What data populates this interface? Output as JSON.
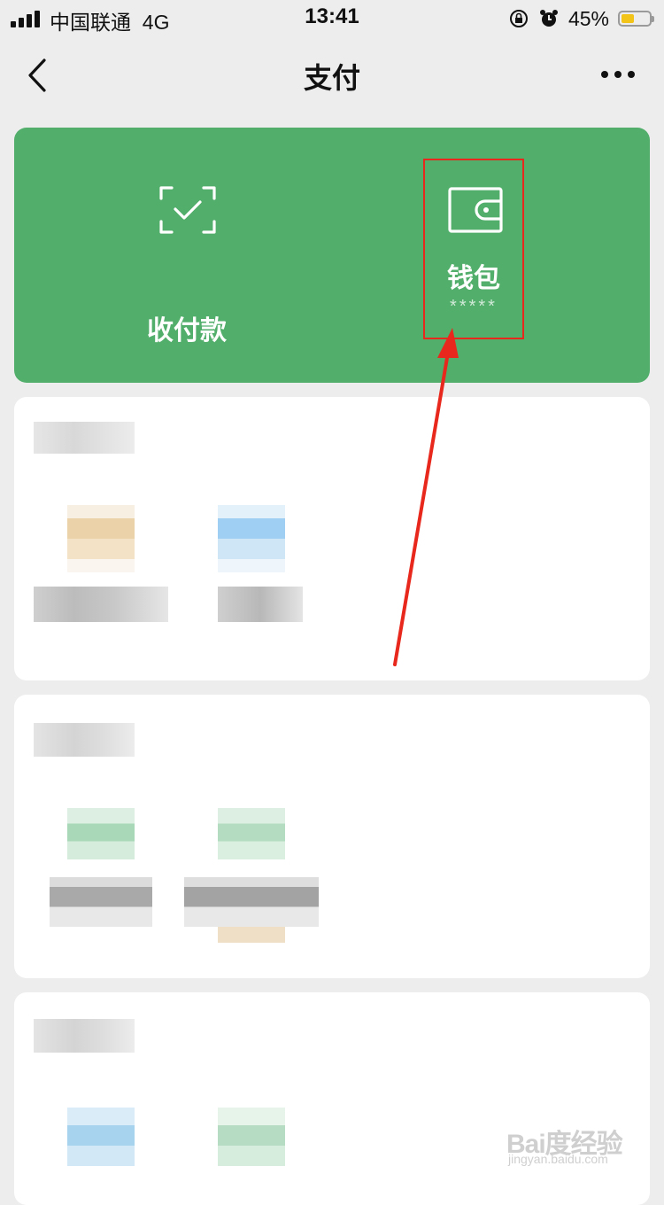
{
  "status_bar": {
    "carrier": "中国联通",
    "network": "4G",
    "time": "13:41",
    "battery_percent": "45%",
    "battery_level": 0.45,
    "battery_color": "#f2c318"
  },
  "nav": {
    "title": "支付",
    "back_icon": "chevron-left-icon",
    "more_icon": "more-dots-icon"
  },
  "green_card": {
    "color": "#52ae6b",
    "pay_action": {
      "label": "收付款",
      "icon": "scan-check-icon"
    },
    "wallet_action": {
      "label": "钱包",
      "balance_mask": "*****",
      "icon": "wallet-icon"
    }
  },
  "annotation_color": "#e8281c",
  "watermark": {
    "main": "Bai度经验",
    "sub": "jingyan.baidu.com"
  }
}
